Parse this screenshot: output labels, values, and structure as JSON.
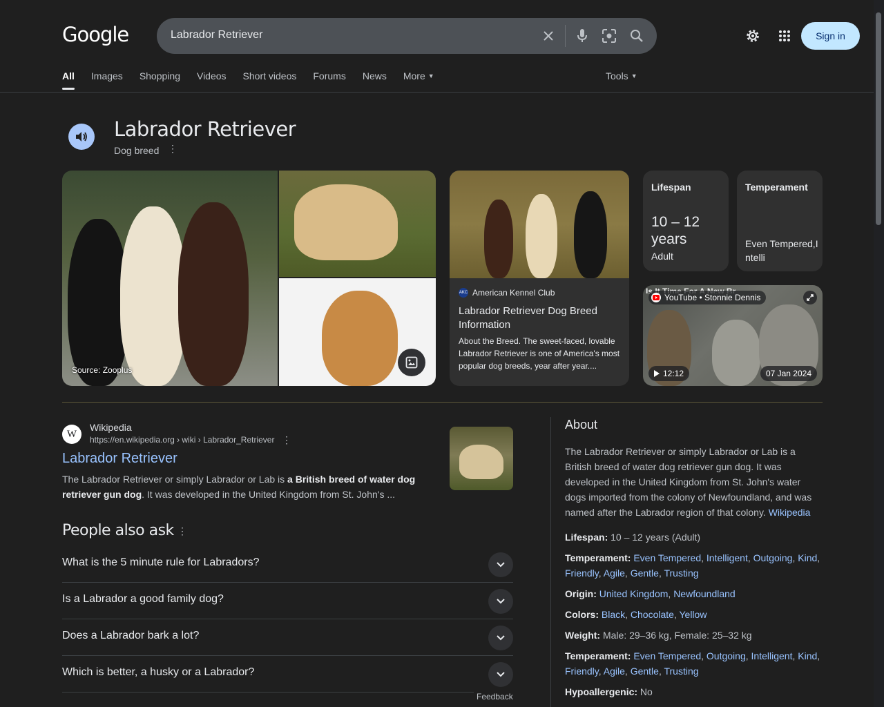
{
  "header": {
    "logo": "Google",
    "query": "Labrador Retriever",
    "sign_in": "Sign in"
  },
  "tabs": [
    "All",
    "Images",
    "Shopping",
    "Videos",
    "Short videos",
    "Forums",
    "News",
    "More"
  ],
  "tools": "Tools",
  "knowledge": {
    "title": "Labrador Retriever",
    "subtitle": "Dog breed",
    "image_source": "Source: Zooplus"
  },
  "akc_card": {
    "source": "American Kennel Club",
    "favicon_text": "AKC",
    "title": "Labrador Retriever Dog Breed Information",
    "desc": "About the Breed. The sweet-faced, lovable Labrador Retriever is one of America's most popular dog breeds, year after year...."
  },
  "stats": [
    {
      "label": "Lifespan",
      "value": "10 – 12 years",
      "sub": "Adult"
    },
    {
      "label": "Temperament",
      "value": "",
      "sub": "Even Tempered,Intelli"
    }
  ],
  "video": {
    "channel": "YouTube • Stonnie Dennis",
    "overlay_title": "Is It Time For A New Breed Standard?",
    "duration": "12:12",
    "date": "07 Jan 2024"
  },
  "result": {
    "site": "Wikipedia",
    "url": "https://en.wikipedia.org › wiki › Labrador_Retriever",
    "title": "Labrador Retriever",
    "snippet_pre": "The Labrador Retriever or simply Labrador or Lab is ",
    "snippet_bold": "a British breed of water dog retriever gun dog",
    "snippet_post": ". It was developed in the United Kingdom from St. John's ..."
  },
  "paa": {
    "title": "People also ask",
    "questions": [
      "What is the 5 minute rule for Labradors?",
      "Is a Labrador a good family dog?",
      "Does a Labrador bark a lot?",
      "Which is better, a husky or a Labrador?"
    ],
    "feedback": "Feedback"
  },
  "about": {
    "heading": "About",
    "text": "The Labrador Retriever or simply Labrador or Lab is a British breed of water dog retriever gun dog. It was developed in the United Kingdom from St. John's water dogs imported from the colony of Newfoundland, and was named after the Labrador region of that colony. ",
    "link": "Wikipedia",
    "lifespan_label": "Lifespan:",
    "lifespan_value": "10 – 12 years (Adult)",
    "temperament_label": "Temperament:",
    "temperament_links": [
      "Even Tempered",
      "Intelligent",
      "Outgoing",
      "Kind",
      "Friendly",
      "Agile",
      "Gentle",
      "Trusting"
    ],
    "origin_label": "Origin:",
    "origin_links": [
      "United Kingdom",
      "Newfoundland"
    ],
    "colors_label": "Colors:",
    "colors_links": [
      "Black",
      "Chocolate",
      "Yellow"
    ],
    "weight_label": "Weight:",
    "weight_value": "Male: 29–36 kg, Female: 25–32 kg",
    "temperament2_label": "Temperament:",
    "temperament2_links": [
      "Even Tempered",
      "Outgoing",
      "Intelligent",
      "Kind",
      "Friendly",
      "Agile",
      "Gentle",
      "Trusting"
    ],
    "hypo_label": "Hypoallergenic:",
    "hypo_value": "No"
  },
  "colors": {
    "background": "#1f1f1f",
    "link": "#99c3ff",
    "sign_in_bg": "#c2e7ff",
    "search_bg": "#4d5156"
  },
  "icons": [
    "clear-icon",
    "mic-icon",
    "lens-icon",
    "search-icon",
    "settings-gear-icon",
    "apps-grid-icon",
    "speaker-icon",
    "more-vert-icon",
    "image-search-icon",
    "youtube-icon",
    "expand-icon",
    "play-icon",
    "chevron-down-icon"
  ]
}
